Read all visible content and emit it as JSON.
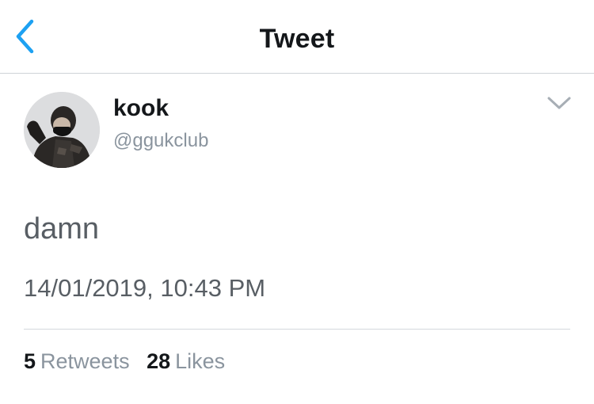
{
  "header": {
    "title": "Tweet",
    "back_icon": "chevron-left-icon",
    "accent_color": "#1da1f2"
  },
  "author": {
    "display_name": "kook",
    "handle": "@ggukclub"
  },
  "tweet": {
    "text": "damn",
    "timestamp": "14/01/2019, 10:43 PM"
  },
  "stats": {
    "retweets_count": "5",
    "retweets_label": "Retweets",
    "likes_count": "28",
    "likes_label": "Likes"
  },
  "colors": {
    "primary_text": "#14171a",
    "secondary_text": "#8a949e",
    "body_text": "#585e64",
    "divider": "#cfd3d7"
  }
}
